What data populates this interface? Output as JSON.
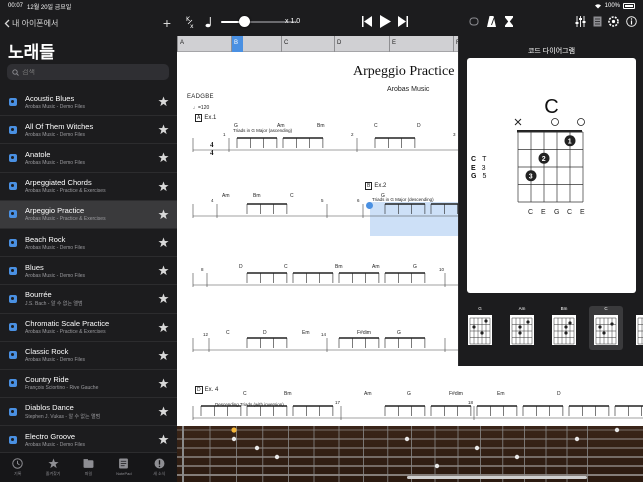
{
  "status_bar": {
    "time": "00:07",
    "date": "12월 20일 금요일",
    "battery": "100%"
  },
  "sidebar": {
    "back_label": "내 아이폰에서",
    "title": "노래들",
    "search_placeholder": "검색",
    "items": [
      {
        "title": "Acoustic Blues",
        "subtitle": "Arobas Music - Demo Files",
        "selected": false
      },
      {
        "title": "All Of Them Witches",
        "subtitle": "Arobas Music - Demo Files",
        "selected": false
      },
      {
        "title": "Anatole",
        "subtitle": "Arobas Music - Demo Files",
        "selected": false
      },
      {
        "title": "Arpeggiated Chords",
        "subtitle": "Arobas Music - Practice & Exercises",
        "selected": false
      },
      {
        "title": "Arpeggio Practice",
        "subtitle": "Arobas Music - Practice & Exercises",
        "selected": true
      },
      {
        "title": "Beach Rock",
        "subtitle": "Arobas Music - Demo Files",
        "selected": false
      },
      {
        "title": "Blues",
        "subtitle": "Arobas Music - Demo Files",
        "selected": false
      },
      {
        "title": "Bourrée",
        "subtitle": "J.S. Bach - 알 수 없는 앨범",
        "selected": false
      },
      {
        "title": "Chromatic Scale Practice",
        "subtitle": "Arobas Music - Practice & Exercises",
        "selected": false
      },
      {
        "title": "Classic Rock",
        "subtitle": "Arobas Music - Demo Files",
        "selected": false
      },
      {
        "title": "Country Ride",
        "subtitle": "François Sciortino - Rive Gauche",
        "selected": false
      },
      {
        "title": "Diablos Dance",
        "subtitle": "Stephen J. Vukas - 알 수 없는 앨범",
        "selected": false
      },
      {
        "title": "Electro Groove",
        "subtitle": "Arobas Music - Demo Files",
        "selected": false
      }
    ],
    "tabs": [
      {
        "label": "기록",
        "icon": "clock-icon"
      },
      {
        "label": "즐겨찾기",
        "icon": "star-icon"
      },
      {
        "label": "파일",
        "icon": "folder-icon"
      },
      {
        "label": "NotePad",
        "icon": "notepad-icon"
      },
      {
        "label": "새 소식",
        "icon": "news-icon"
      }
    ]
  },
  "toolbar": {
    "speed": "x 1.0",
    "speed_value": 1.0
  },
  "ruler": {
    "sections": [
      "A",
      "B",
      "C",
      "D",
      "E",
      "F"
    ],
    "active": "B"
  },
  "score": {
    "title": "Arpeggio Practice",
    "artist": "Arobas Music",
    "tuning": "EADGBE",
    "tempo": "♩=120",
    "ex1": "Ex.1",
    "ex1_desc": "Triads in G Major (ascending)",
    "ex2": "Ex.2",
    "ex2_desc": "Triads in G Major (descending)",
    "ex3": "Ex. 4",
    "ex3_desc": "Descending Triads (with inversion)",
    "time_sig_top": "4",
    "time_sig_bottom": "4",
    "systems": [
      {
        "measures": [
          "1",
          "2",
          "3"
        ],
        "chords": [
          "G",
          "Am",
          "Bm",
          "C",
          "D"
        ]
      },
      {
        "measures": [
          "4",
          "5",
          "6"
        ],
        "chords": [
          "Am",
          "Bm",
          "C",
          "G"
        ]
      },
      {
        "measures": [
          "8",
          "10"
        ],
        "chords": [
          "D",
          "C",
          "Bm",
          "Am",
          "G"
        ]
      },
      {
        "measures": [
          "12",
          "14"
        ],
        "chords": [
          "C",
          "D",
          "Em",
          "F#dim",
          "G"
        ]
      },
      {
        "measures": [
          "17",
          "18"
        ],
        "chords": [
          "C",
          "Bm",
          "Am",
          "G",
          "F#dim",
          "Em",
          "D",
          "C"
        ]
      }
    ]
  },
  "chord_panel": {
    "title": "코드 다이어그램",
    "chord_name": "C",
    "notes": [
      {
        "note": "C",
        "interval": "T"
      },
      {
        "note": "E",
        "interval": "3"
      },
      {
        "note": "G",
        "interval": "5"
      }
    ],
    "string_notes": [
      "C",
      "E",
      "G",
      "C",
      "E"
    ],
    "fingers": [
      "3",
      "2",
      "1"
    ],
    "strip": [
      {
        "name": "G",
        "selected": false
      },
      {
        "name": "Am",
        "selected": false
      },
      {
        "name": "Bm",
        "selected": false
      },
      {
        "name": "C",
        "selected": true
      },
      {
        "name": "D",
        "selected": false
      }
    ]
  }
}
